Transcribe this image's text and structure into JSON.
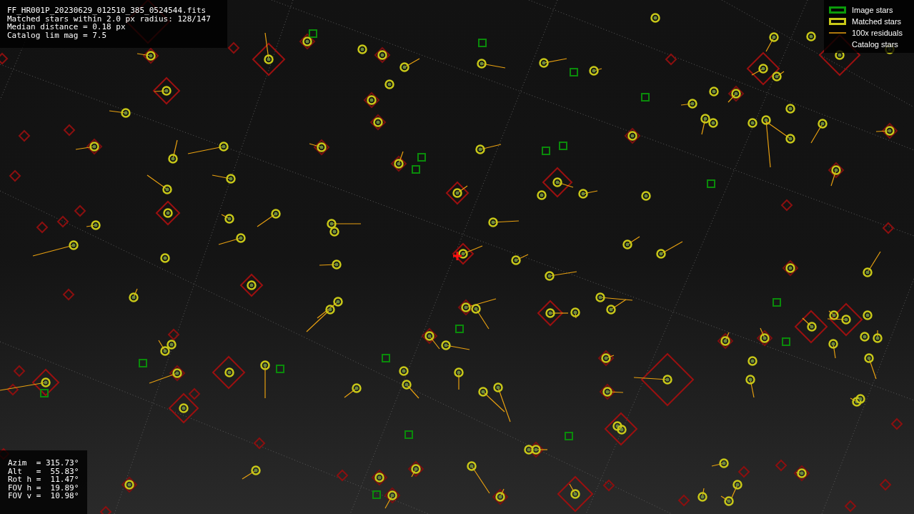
{
  "file_info": {
    "lines": [
      "FF_HR001P_20230629_012510_385_0524544.fits",
      "Matched stars within 2.0 px radius: 128/147",
      "Median distance = 0.18 px",
      "Catalog lim mag = 7.5"
    ]
  },
  "legend": [
    {
      "kind": "image",
      "label": "Image stars"
    },
    {
      "kind": "matched",
      "label": "Matched stars"
    },
    {
      "kind": "residual",
      "label": "100x residuals"
    },
    {
      "kind": "catalog",
      "label": "Catalog stars"
    }
  ],
  "pointing": {
    "lines": [
      "Azim  = 315.73°",
      "Alt   =  55.83°",
      "Rot h =  11.47°",
      "FOV h =  19.89°",
      "FOV v =  10.98°"
    ]
  }
}
